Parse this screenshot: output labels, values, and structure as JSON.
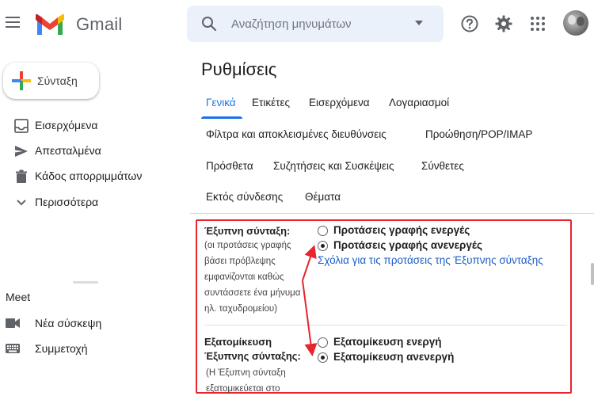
{
  "header": {
    "brand": "Gmail",
    "search_placeholder": "Αναζήτηση μηνυμάτων",
    "icons": [
      "menu-icon",
      "help-icon",
      "gear-icon",
      "apps-grid-icon"
    ]
  },
  "sidebar": {
    "compose_label": "Σύνταξη",
    "items": [
      {
        "label": "Εισερχόμενα",
        "icon": "inbox-icon"
      },
      {
        "label": "Απεσταλμένα",
        "icon": "send-icon"
      },
      {
        "label": "Κάδος απορριμμάτων",
        "icon": "trash-icon"
      },
      {
        "label": "Περισσότερα",
        "icon": "chevron-down-icon"
      }
    ],
    "meet": {
      "title": "Meet",
      "items": [
        {
          "label": "Νέα σύσκεψη",
          "icon": "video-icon"
        },
        {
          "label": "Συμμετοχή",
          "icon": "keyboard-icon"
        }
      ]
    }
  },
  "settings": {
    "title": "Ρυθμίσεις",
    "tabs": [
      {
        "label": "Γενικά",
        "active": true
      },
      {
        "label": "Ετικέτες"
      },
      {
        "label": "Εισερχόμενα"
      },
      {
        "label": "Λογαριασμοί"
      },
      {
        "label": "Φίλτρα και αποκλεισμένες διευθύνσεις"
      },
      {
        "label": "Προώθηση/POP/IMAP"
      },
      {
        "label": "Πρόσθετα"
      },
      {
        "label": "Συζητήσεις και Συσκέψεις"
      },
      {
        "label": "Σύνθετες"
      },
      {
        "label": "Εκτός σύνδεσης"
      },
      {
        "label": "Θέματα"
      }
    ],
    "smart_compose": {
      "label": "Έξυπνη σύνταξη:",
      "description_lines": [
        "(οι προτάσεις γραφής",
        "βάσει πρόβλεψης",
        "εμφανίζονται καθώς",
        "συντάσσετε ένα μήνυμα",
        "ηλ. ταχυδρομείου)"
      ],
      "options": [
        {
          "label": "Προτάσεις γραφής ενεργές",
          "checked": false
        },
        {
          "label": "Προτάσεις γραφής ανενεργές",
          "checked": true
        }
      ],
      "feedback_link": "Σχόλια για τις προτάσεις της Έξυπνης σύνταξης"
    },
    "personalization": {
      "label_lines": [
        "Εξατομίκευση",
        "Έξυπνης σύνταξης:"
      ],
      "description_lines": [
        "(Η Έξυπνη σύνταξη",
        "εξατομικεύεται στο"
      ],
      "options": [
        {
          "label": "Εξατομίκευση ενεργή",
          "checked": false
        },
        {
          "label": "Εξατομίκευση ανενεργή",
          "checked": true
        }
      ]
    }
  },
  "colors": {
    "accent": "#1a73e8",
    "highlight": "#e8242c",
    "link": "#1a5dc9"
  }
}
